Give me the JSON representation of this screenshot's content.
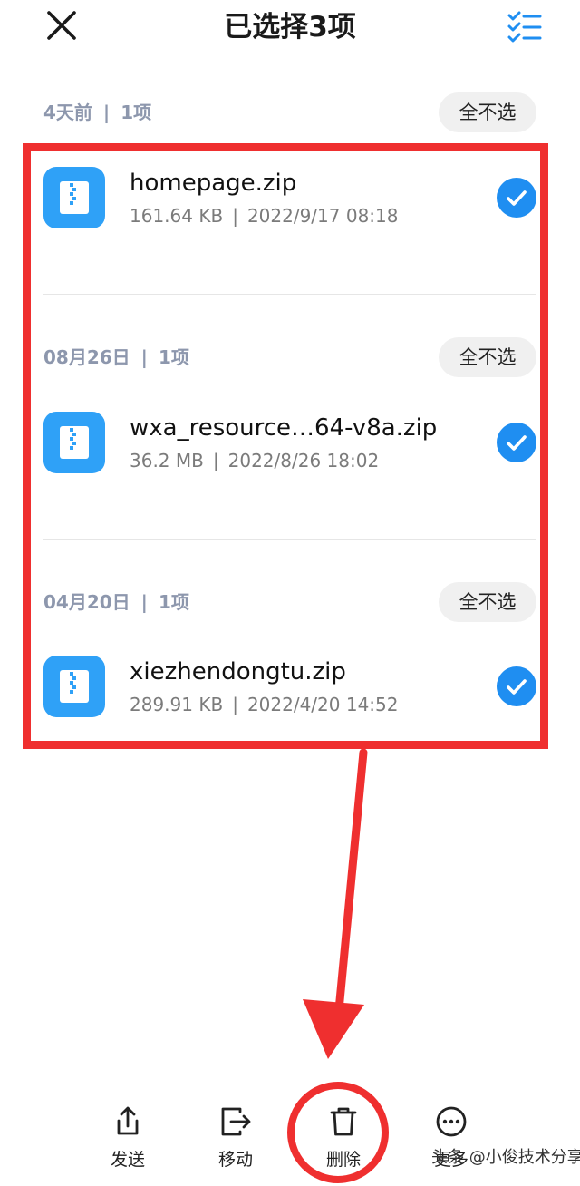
{
  "header": {
    "title": "已选择3项",
    "close_icon": "close-icon",
    "select_all_icon": "checklist-icon"
  },
  "groups": [
    {
      "date": "4天前",
      "count": "1项",
      "deselect_label": "全不选",
      "file": {
        "name": "homepage.zip",
        "size": "161.64 KB",
        "datetime": "2022/9/17 08:18",
        "checked": true
      }
    },
    {
      "date": "08月26日",
      "count": "1项",
      "deselect_label": "全不选",
      "file": {
        "name": "wxa_resource…64-v8a.zip",
        "size": "36.2 MB",
        "datetime": "2022/8/26 18:02",
        "checked": true
      }
    },
    {
      "date": "04月20日",
      "count": "1项",
      "deselect_label": "全不选",
      "file": {
        "name": "xiezhendongtu.zip",
        "size": "289.91 KB",
        "datetime": "2022/4/20 14:52",
        "checked": true
      }
    }
  ],
  "separator": "|",
  "bottom_bar": [
    {
      "label": "发送",
      "icon": "share-icon"
    },
    {
      "label": "移动",
      "icon": "move-icon"
    },
    {
      "label": "删除",
      "icon": "trash-icon"
    },
    {
      "label": "更多",
      "icon": "more-icon"
    }
  ],
  "watermark": "头条 @小俊技术分享",
  "colors": {
    "accent": "#1f8ef1",
    "file_icon": "#2fa1f7",
    "highlight": "#ef2f2f",
    "group_label": "#8d97ad"
  }
}
